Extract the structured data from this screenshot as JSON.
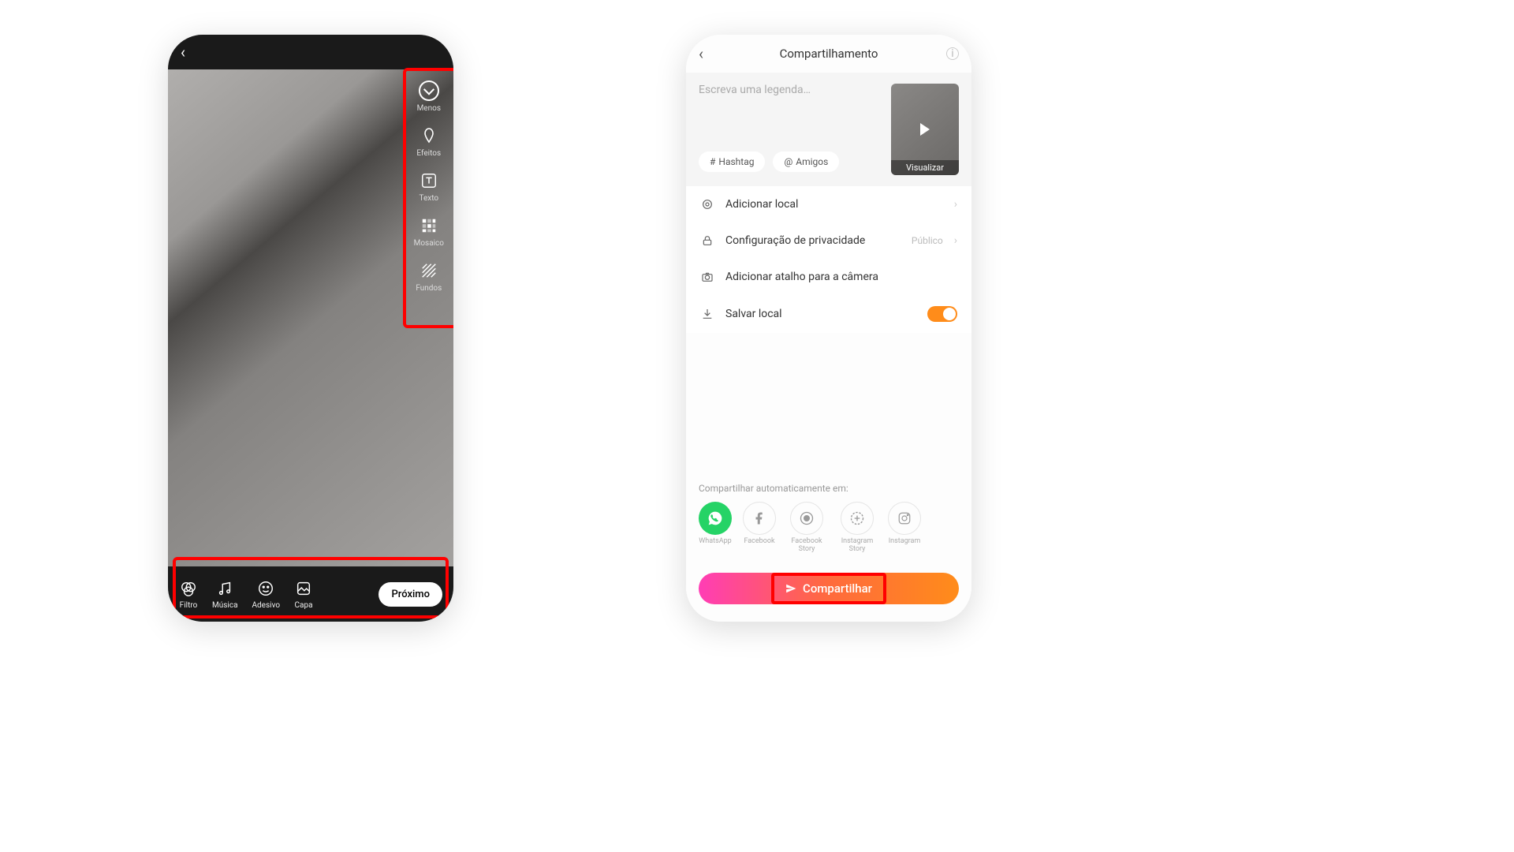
{
  "editor": {
    "side_tools": [
      {
        "id": "menos",
        "label": "Menos"
      },
      {
        "id": "efeitos",
        "label": "Efeitos"
      },
      {
        "id": "texto",
        "label": "Texto"
      },
      {
        "id": "mosaico",
        "label": "Mosaico"
      },
      {
        "id": "fundos",
        "label": "Fundos"
      }
    ],
    "bottom_tools": [
      {
        "id": "filtro",
        "label": "Filtro"
      },
      {
        "id": "musica",
        "label": "Música"
      },
      {
        "id": "adesivo",
        "label": "Adesivo"
      },
      {
        "id": "capa",
        "label": "Capa"
      }
    ],
    "next_label": "Próximo"
  },
  "share": {
    "title": "Compartilhamento",
    "caption_placeholder": "Escreva uma legenda…",
    "chips": {
      "hashtag": "Hashtag",
      "amigos": "Amigos"
    },
    "thumb_label": "Visualizar",
    "options": {
      "location": "Adicionar local",
      "privacy": "Configuração de privacidade",
      "privacy_value": "Público",
      "camera_shortcut": "Adicionar atalho para a câmera",
      "save_local": "Salvar local"
    },
    "save_local_on": true,
    "auto_share_title": "Compartilhar automaticamente em:",
    "socials": [
      {
        "id": "whatsapp",
        "label": "WhatsApp"
      },
      {
        "id": "facebook",
        "label": "Facebook"
      },
      {
        "id": "facebook-story",
        "label": "Facebook Story"
      },
      {
        "id": "instagram-story",
        "label": "Instagram Story"
      },
      {
        "id": "instagram",
        "label": "Instagram"
      }
    ],
    "share_button": "Compartilhar"
  }
}
